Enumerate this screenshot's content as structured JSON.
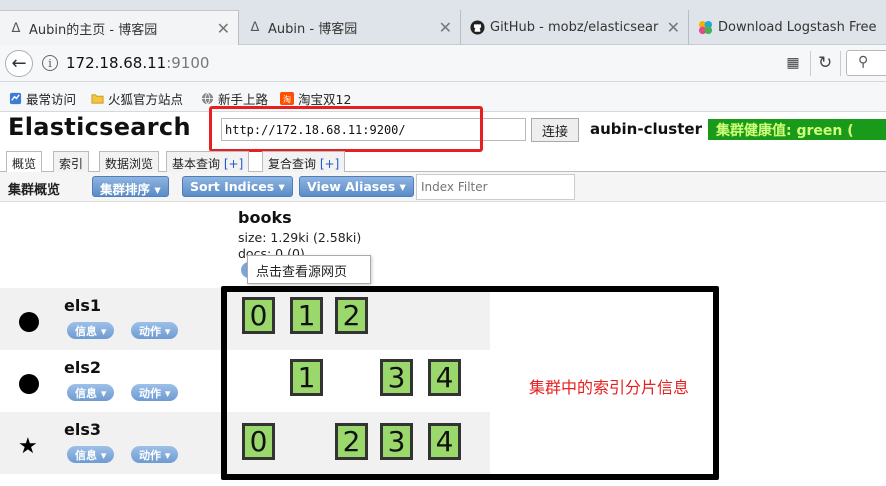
{
  "browser": {
    "tabs": [
      {
        "title": "Aubin的主页 - 博客园",
        "icon": "cnblogs-icon",
        "close": "✕"
      },
      {
        "title": "Aubin - 博客园",
        "icon": "cnblogs-icon",
        "close": "✕"
      },
      {
        "title": "GitHub - mobz/elasticsear",
        "icon": "github-icon",
        "close": "✕"
      },
      {
        "title": "Download Logstash Free",
        "icon": "elastic-icon",
        "close": ""
      }
    ],
    "url_host": "172.18.68.11",
    "url_port": ":9100",
    "bookmarks": [
      {
        "label": "最常访问",
        "icon": "frequent-icon"
      },
      {
        "label": "火狐官方站点",
        "icon": "folder-icon"
      },
      {
        "label": "新手上路",
        "icon": "globe-icon"
      },
      {
        "label": "淘宝双12",
        "icon": "taobao-icon"
      }
    ]
  },
  "app": {
    "title": "Elasticsearch",
    "url_value": "http://172.18.68.11:9200/",
    "connect_label": "连接",
    "cluster_name": "aubin-cluster",
    "health_label": "集群健康值: green ("
  },
  "tabs": [
    {
      "label": "概览",
      "plus": ""
    },
    {
      "label": "索引",
      "plus": ""
    },
    {
      "label": "数据浏览",
      "plus": ""
    },
    {
      "label": "基本查询 ",
      "plus": "[+]"
    },
    {
      "label": "复合查询 ",
      "plus": "[+]"
    }
  ],
  "toolbar": {
    "overview_label": "集群概览",
    "sort_label": "集群排序 ▾",
    "sort_indices_label": "Sort Indices ▾",
    "view_aliases_label": "View Aliases ▾",
    "index_filter_placeholder": "Index Filter"
  },
  "index": {
    "name": "books",
    "size": "size: 1.29ki (2.58ki)",
    "docs": "docs: 0 (0)",
    "tooltip": "点击查看源网页"
  },
  "nodes": [
    {
      "name": "els1",
      "marker": "dot",
      "info_label": "信息 ▾",
      "action_label": "动作 ▾",
      "shards": [
        "0",
        "1",
        "2"
      ]
    },
    {
      "name": "els2",
      "marker": "dot",
      "info_label": "信息 ▾",
      "action_label": "动作 ▾",
      "shards": [
        "1",
        "3",
        "4"
      ]
    },
    {
      "name": "els3",
      "marker": "star",
      "info_label": "信息 ▾",
      "action_label": "动作 ▾",
      "shards": [
        "0",
        "2",
        "3",
        "4"
      ]
    }
  ],
  "annotation": "集群中的索引分片信息",
  "colors": {
    "shard_fill": "#9ad86c",
    "health_green": "#1a9a1a",
    "highlight_red": "#e62020",
    "button_blue": "#5a8cc8"
  }
}
